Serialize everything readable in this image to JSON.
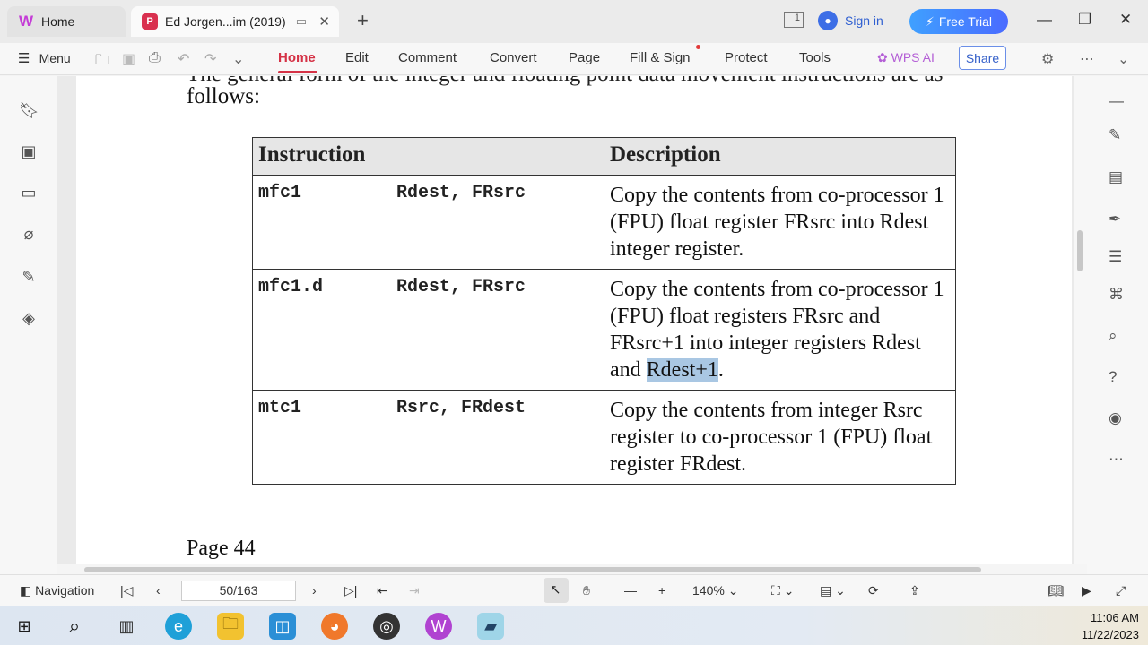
{
  "titlebar": {
    "tabs": [
      {
        "label": "Home"
      },
      {
        "label": "Ed Jorgen...im (2019)"
      }
    ],
    "signin": "Sign in",
    "free_trial": "Free Trial",
    "badge_count": "1"
  },
  "menu": {
    "menu_label": "Menu",
    "items": [
      "Home",
      "Edit",
      "Comment",
      "Convert",
      "Page",
      "Fill & Sign",
      "Protect",
      "Tools"
    ],
    "wps_ai": "WPS AI",
    "share": "Share"
  },
  "document": {
    "partial_line": "The general form of the integer and floating point data movement instructions are as",
    "follows": "follows:",
    "table": {
      "headers": [
        "Instruction",
        "Description"
      ],
      "rows": [
        {
          "mnemonic": "mfc1",
          "operands": "Rdest, FRsrc",
          "description": "Copy the contents from co-processor 1 (FPU) float register FRsrc into Rdest integer register."
        },
        {
          "mnemonic": "mfc1.d",
          "operands": "Rdest, FRsrc",
          "description_pre": "Copy the contents from co-processor 1 (FPU) float registers FRsrc and FRsrc+1 into integer registers Rdest and ",
          "description_hl": "Rdest+1",
          "description_post": "."
        },
        {
          "mnemonic": "mtc1",
          "operands": "Rsrc, FRdest",
          "description": "Copy the contents from integer Rsrc register to co-processor 1 (FPU) float register FRdest."
        }
      ]
    },
    "page_footer": "Page 44"
  },
  "statusbar": {
    "navigation": "Navigation",
    "page_indicator": "50/163",
    "zoom": "140%"
  },
  "taskbar": {
    "time": "11:06 AM",
    "date": "11/22/2023"
  },
  "colors": {
    "accent_red": "#d53246",
    "highlight": "#a9c7e3",
    "free_trial": "#4a6bff"
  }
}
